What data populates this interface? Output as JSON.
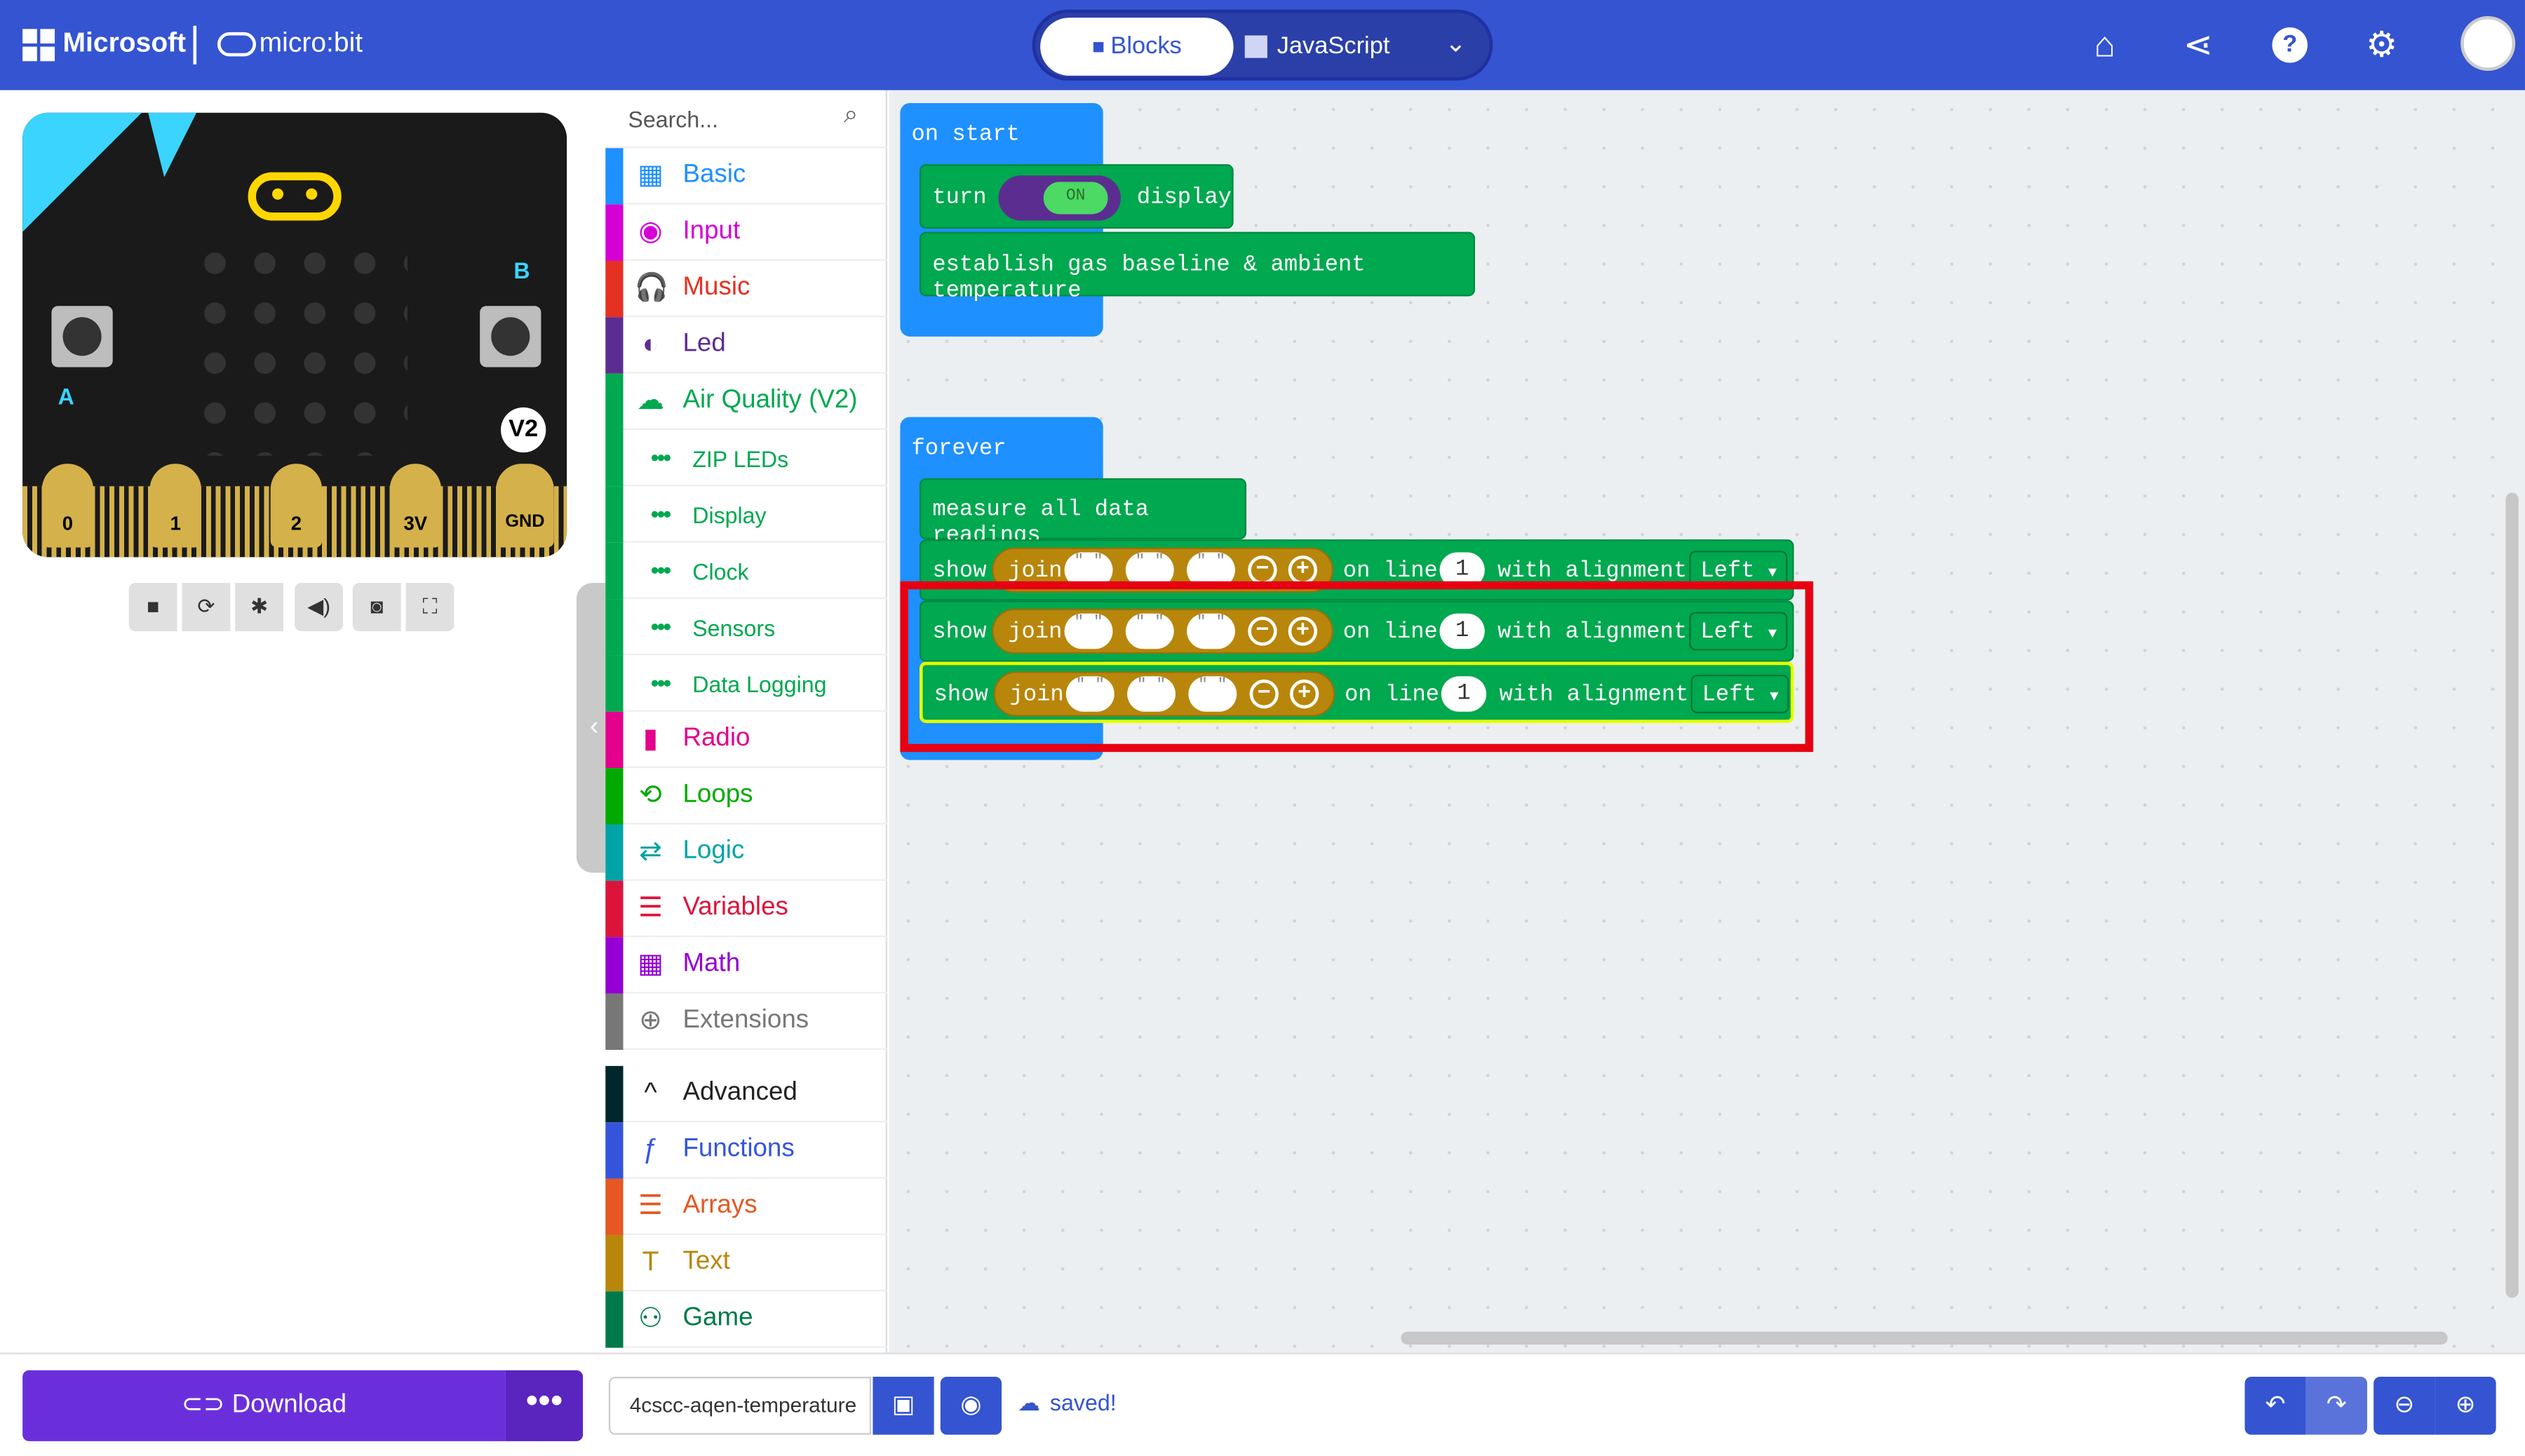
{
  "header": {
    "brand_microsoft": "Microsoft",
    "brand_microbit": "micro:bit",
    "tabs": [
      {
        "label": "Blocks",
        "icon": "puzzle-icon"
      },
      {
        "label": "JavaScript",
        "icon": "js-icon"
      }
    ],
    "icons": [
      "home-icon",
      "share-icon",
      "help-icon",
      "settings-icon",
      "avatar"
    ]
  },
  "simulator": {
    "badge": "V2",
    "button_a": "A",
    "button_b": "B",
    "pins": [
      "0",
      "1",
      "2",
      "3V",
      "GND"
    ],
    "controls": [
      "stop-icon",
      "restart-icon",
      "debug-icon",
      "mute-icon",
      "screenshot-icon",
      "fullscreen-icon"
    ]
  },
  "toolbox": {
    "search_placeholder": "Search...",
    "categories": [
      {
        "label": "Basic",
        "color": "#1e90ff"
      },
      {
        "label": "Input",
        "color": "#d400d4"
      },
      {
        "label": "Music",
        "color": "#e63022"
      },
      {
        "label": "Led",
        "color": "#5c2d91"
      },
      {
        "label": "Air Quality (V2)",
        "color": "#00a84f"
      },
      {
        "label": "ZIP LEDs",
        "color": "#00a84f"
      },
      {
        "label": "Display",
        "color": "#00a84f"
      },
      {
        "label": "Clock",
        "color": "#00a84f"
      },
      {
        "label": "Sensors",
        "color": "#00a84f"
      },
      {
        "label": "Data Logging",
        "color": "#00a84f"
      },
      {
        "label": "Radio",
        "color": "#e3008c"
      },
      {
        "label": "Loops",
        "color": "#00aa00"
      },
      {
        "label": "Logic",
        "color": "#00a4a6"
      },
      {
        "label": "Variables",
        "color": "#dc143c"
      },
      {
        "label": "Math",
        "color": "#9400d3"
      },
      {
        "label": "Extensions",
        "color": "#777777"
      },
      {
        "label": "Advanced",
        "color": "#00272b"
      },
      {
        "label": "Functions",
        "color": "#3455db"
      },
      {
        "label": "Arrays",
        "color": "#e65722"
      },
      {
        "label": "Text",
        "color": "#b8860b"
      },
      {
        "label": "Game",
        "color": "#007a4b"
      }
    ]
  },
  "workspace": {
    "on_start": "on start",
    "turn": "turn",
    "toggle_on": "ON",
    "display": "display",
    "establish": "establish gas baseline & ambient temperature",
    "forever": "forever",
    "measure": "measure all data readings",
    "show": "show",
    "join": "join",
    "quote": "\" \"",
    "minus": "−",
    "plus": "+",
    "on_line": "on line",
    "line_value": "1",
    "with_alignment": "with alignment:",
    "alignment_value": "Left"
  },
  "footer": {
    "download": "Download",
    "more": "•••",
    "project_name": "4cscc-aqen-temperature",
    "saved": "saved!"
  }
}
